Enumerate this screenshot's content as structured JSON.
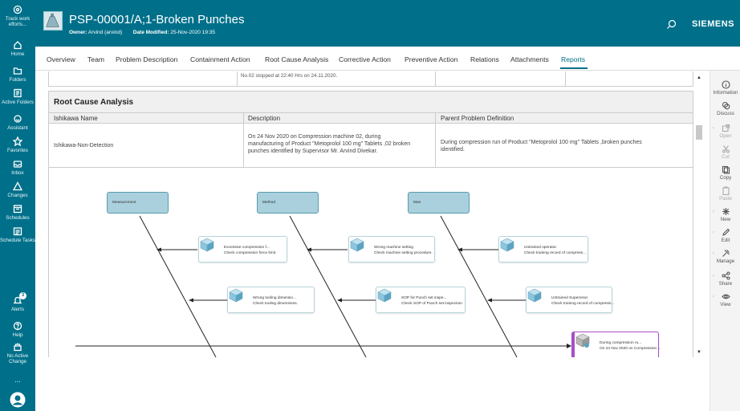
{
  "window": {
    "title": "PSP-00001/A;1-Broken Punches",
    "owner_label": "Owner:",
    "owner_value": "Arvind (arvind)",
    "date_label": "Date Modified:",
    "date_value": "25-Nov-2020 19:35",
    "brand": "SIEMENS"
  },
  "sidebar": {
    "items": [
      {
        "label": "Track work efforts...",
        "icon": "target-icon"
      },
      {
        "label": "Home",
        "icon": "home-icon"
      },
      {
        "label": "Folders",
        "icon": "folder-icon"
      },
      {
        "label": "Active Folders",
        "icon": "active-folders-icon"
      },
      {
        "label": "Assistant",
        "icon": "assistant-icon"
      },
      {
        "label": "Favorites",
        "icon": "star-icon"
      },
      {
        "label": "Inbox",
        "icon": "inbox-icon"
      },
      {
        "label": "Changes",
        "icon": "triangle-icon"
      },
      {
        "label": "Schedules",
        "icon": "schedules-icon"
      },
      {
        "label": "Schedule Tasks",
        "icon": "schedule-tasks-icon"
      },
      {
        "label": "Alerts",
        "icon": "bell-icon",
        "badge": "3"
      },
      {
        "label": "Help",
        "icon": "help-icon"
      },
      {
        "label": "No Active Change",
        "icon": "change-icon"
      },
      {
        "label": "...",
        "icon": "more-icon"
      },
      {
        "label": "",
        "icon": "avatar-icon"
      }
    ]
  },
  "tabs": [
    {
      "label": "Overview",
      "active": false
    },
    {
      "label": "Team",
      "active": false
    },
    {
      "label": "Problem Description",
      "active": false
    },
    {
      "label": "Containment Action",
      "active": false
    },
    {
      "label": "Root Cause Analysis",
      "active": false
    },
    {
      "label": "Corrective Action",
      "active": false
    },
    {
      "label": "Preventive Action",
      "active": false
    },
    {
      "label": "Relations",
      "active": false
    },
    {
      "label": "Attachments",
      "active": false
    },
    {
      "label": "Reports",
      "active": true
    }
  ],
  "report": {
    "prev_table_text": "No.02 stopped at 22:40 Hrs on 24.11.2020.",
    "section_title": "Root Cause Analysis",
    "columns": [
      "Ishikawa Name",
      "Description",
      "Parent Problem Definition"
    ],
    "row": {
      "name": "Ishikawa-Non-Detection",
      "description": [
        "On 24 Nov 2020 on Compression machine 02, during",
        "manufacturing of Product \"Metoprolol 100 mg\" Tablets ,02 broken",
        "punches identified by Supervisor Mr. Arvind Divekar."
      ],
      "parent": [
        "During compression run of Product \"Metoprolol 100 mg\" Tablets ,broken punches",
        "identified."
      ]
    }
  },
  "diagram": {
    "categories": [
      "Measurement",
      "Method",
      "Man"
    ],
    "causes": [
      {
        "line1": "Excessive compression f...",
        "line2": "Check compression force limit."
      },
      {
        "line1": "Wrong machine setting",
        "line2": "Check machine setting procedure."
      },
      {
        "line1": "Untrained operator.",
        "line2": "Check training record of compress..."
      },
      {
        "line1": "Wrong tooling dimensio...",
        "line2": "Check tooling dimensions."
      },
      {
        "line1": "SOP for Punch set inspe...",
        "line2": "Check SOP of Punch set inspection"
      },
      {
        "line1": "Untrained Supervisor.",
        "line2": "Check training record of compressi..."
      }
    ],
    "problem": {
      "line1": "During compression ru...",
      "line2": "On 24 Nov 2020 on Compression ..."
    }
  },
  "rightbar": {
    "items": [
      {
        "label": "Information",
        "icon": "info-icon",
        "enabled": true
      },
      {
        "label": "Discuss",
        "icon": "discuss-icon",
        "enabled": true
      },
      {
        "label": "Open",
        "icon": "open-icon",
        "enabled": false
      },
      {
        "label": "Cut",
        "icon": "cut-icon",
        "enabled": false
      },
      {
        "label": "Copy",
        "icon": "copy-icon",
        "enabled": true
      },
      {
        "label": "Paste",
        "icon": "paste-icon",
        "enabled": false
      },
      {
        "label": "New",
        "icon": "new-icon",
        "enabled": true
      },
      {
        "label": "Edit",
        "icon": "edit-icon",
        "enabled": true
      },
      {
        "label": "Manage",
        "icon": "manage-icon",
        "enabled": true
      },
      {
        "label": "Share",
        "icon": "share-icon",
        "enabled": true
      },
      {
        "label": "View",
        "icon": "view-icon",
        "enabled": true
      }
    ]
  }
}
